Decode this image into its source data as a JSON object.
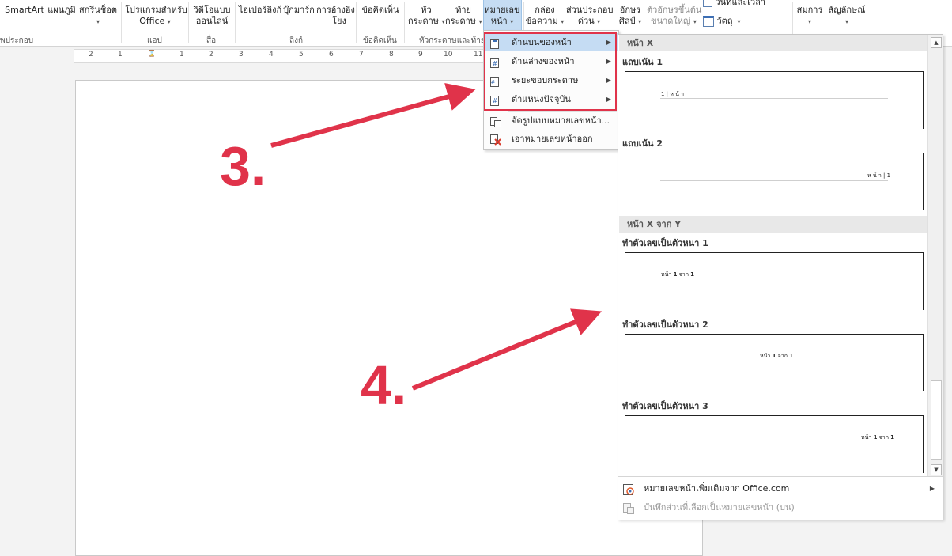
{
  "ribbon": {
    "buttons": [
      {
        "id": "smartart",
        "label": "SmartArt"
      },
      {
        "id": "chart",
        "label": "แผนภูมิ"
      },
      {
        "id": "screenshot",
        "label": "สกรีนช็อต"
      },
      {
        "id": "office_apps_line1",
        "label": "โปรแกรมสำหรับ"
      },
      {
        "id": "office_apps_line2",
        "label": "Office"
      },
      {
        "id": "online_video_line1",
        "label": "วิดีโอแบบ"
      },
      {
        "id": "online_video_line2",
        "label": "ออนไลน์"
      },
      {
        "id": "hyperlink",
        "label": "ไฮเปอร์ลิงก์"
      },
      {
        "id": "bookmark",
        "label": "บุ๊กมาร์ก"
      },
      {
        "id": "crossref_line1",
        "label": "การอ้างอิง"
      },
      {
        "id": "crossref_line2",
        "label": "โยง"
      },
      {
        "id": "comment",
        "label": "ข้อคิดเห็น"
      },
      {
        "id": "header_line1",
        "label": "หัว"
      },
      {
        "id": "header_line2",
        "label": "กระดาษ"
      },
      {
        "id": "footer_line1",
        "label": "ท้าย"
      },
      {
        "id": "footer_line2",
        "label": "กระดาษ"
      },
      {
        "id": "pagenum_line1",
        "label": "หมายเลข"
      },
      {
        "id": "pagenum_line2",
        "label": "หน้า"
      },
      {
        "id": "textbox_line1",
        "label": "กล่อง"
      },
      {
        "id": "textbox_line2",
        "label": "ข้อความ"
      },
      {
        "id": "quickparts_line1",
        "label": "ส่วนประกอบ"
      },
      {
        "id": "quickparts_line2",
        "label": "ด่วน"
      },
      {
        "id": "wordart_line1",
        "label": "อักษร"
      },
      {
        "id": "wordart_line2",
        "label": "ศิลป์"
      },
      {
        "id": "dropcap_line1",
        "label": "ตัวอักษรขึ้นต้น"
      },
      {
        "id": "dropcap_line2",
        "label": "ขนาดใหญ่"
      },
      {
        "id": "datetime",
        "label": "วันที่และเวลา"
      },
      {
        "id": "object",
        "label": "วัตถุ"
      },
      {
        "id": "equation",
        "label": "สมการ"
      },
      {
        "id": "symbol",
        "label": "สัญลักษณ์"
      }
    ],
    "groups": {
      "illustrations": "พประกอบ",
      "apps": "แอป",
      "media": "สื่อ",
      "links": "ลิงก์",
      "comments": "ข้อคิดเห็น",
      "header_footer": "หัวกระดาษและท้ายก"
    }
  },
  "ruler": {
    "labels": [
      "2",
      "1",
      "1",
      "2",
      "3",
      "4",
      "5",
      "6",
      "7",
      "8",
      "9",
      "10",
      "11"
    ]
  },
  "submenu": {
    "items": [
      {
        "label": "ด้านบนของหน้า",
        "has_arrow": true,
        "highlighted": true
      },
      {
        "label": "ด้านล่างของหน้า",
        "has_arrow": true,
        "highlighted": false
      },
      {
        "label": "ระยะขอบกระดาษ",
        "has_arrow": true,
        "highlighted": false
      },
      {
        "label": "ตำแหน่งปัจจุบัน",
        "has_arrow": true,
        "highlighted": false
      },
      {
        "label": "จัดรูปแบบหมายเลขหน้า...",
        "has_arrow": false,
        "highlighted": false
      },
      {
        "label": "เอาหมายเลขหน้าออก",
        "has_arrow": false,
        "highlighted": false
      }
    ],
    "arrow_glyph": "▶"
  },
  "gallery": {
    "section1": "หน้า X",
    "section2": "หน้า X จาก Y",
    "thumbs": [
      {
        "title": "แถบเน้น 1",
        "sample": "1 | ห น้ า"
      },
      {
        "title": "แถบเน้น 2",
        "sample": "ห น้ า | 1"
      },
      {
        "title": "ทำตัวเลขเป็นตัวหนา 1",
        "sample_pre": "หน้า ",
        "sample_n1": "1",
        "sample_mid": " จาก ",
        "sample_n2": "1"
      },
      {
        "title": "ทำตัวเลขเป็นตัวหนา 2",
        "sample_pre": "หน้า ",
        "sample_n1": "1",
        "sample_mid": " จาก ",
        "sample_n2": "1"
      },
      {
        "title": "ทำตัวเลขเป็นตัวหนา 3",
        "sample_pre": "หน้า ",
        "sample_n1": "1",
        "sample_mid": " จาก ",
        "sample_n2": "1"
      }
    ],
    "footer": {
      "more": "หมายเลขหน้าเพิ่มเติมจาก Office.com",
      "save": "บันทึกส่วนที่เลือกเป็นหมายเลขหน้า (บน)"
    },
    "scroll_up": "▲",
    "scroll_down": "▼"
  },
  "callouts": {
    "step3": "3.",
    "step4": "4."
  },
  "colors": {
    "callout": "#e0334a",
    "highlight": "#c5dcf3"
  }
}
